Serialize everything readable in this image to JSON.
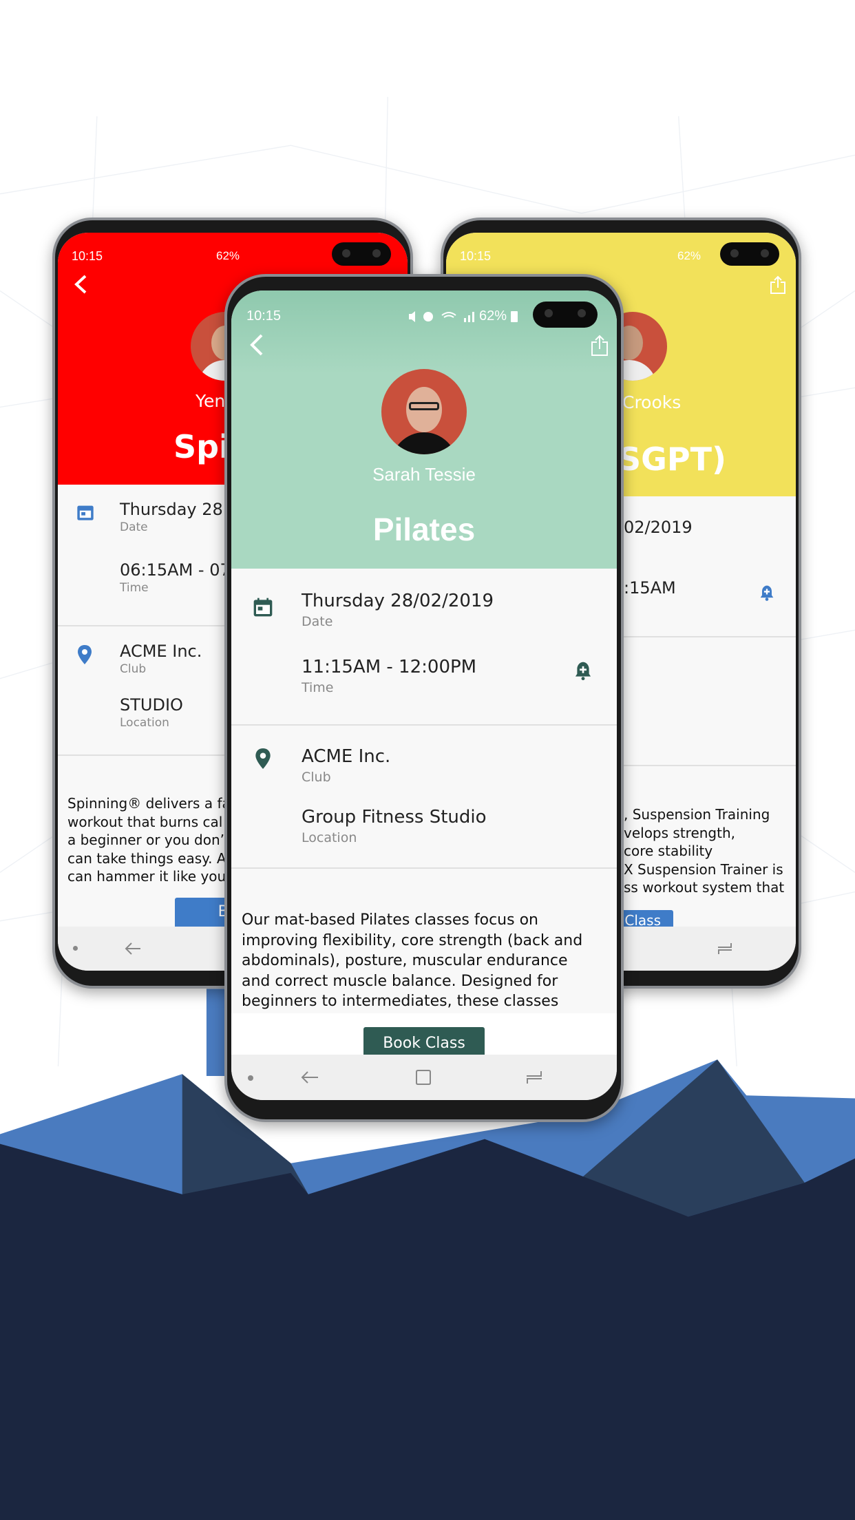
{
  "colors": {
    "red": "#ff0000",
    "yellow": "#f2e15a",
    "green": "#a9d8c1",
    "dark_green": "#2f5b53",
    "blue": "#3f7cc8",
    "navy": "#1b2640",
    "slate": "#2a3f5c",
    "sky": "#4a7bbf"
  },
  "status_bar": {
    "time": "10:15",
    "battery": "62%"
  },
  "left_phone": {
    "trainer": "Yen",
    "title": "Spin",
    "date": "Thursday  28",
    "date_label": "Date",
    "time": "06:15AM - 07",
    "time_label": "Time",
    "club": "ACME Inc.",
    "club_label": "Club",
    "location": "STUDIO",
    "location_label": "Location",
    "description": [
      "Spinning® delivers a fa",
      "workout that burns cal",
      "a beginner or you don’",
      "can take things easy. A",
      "can hammer it like you"
    ],
    "book_label": "Book"
  },
  "right_phone": {
    "trainer": "Crooks",
    "title": "SGPT)",
    "date": "02/2019",
    "time": ":15AM",
    "description": [
      ", Suspension Training",
      "velops strength,",
      "core stability",
      "X Suspension Trainer is",
      "ss workout system that"
    ],
    "book_label": "Class"
  },
  "center_phone": {
    "trainer": "Sarah Tessie",
    "title": "Pilates",
    "date": "Thursday  28/02/2019",
    "date_label": "Date",
    "time": "11:15AM - 12:00PM",
    "time_label": "Time",
    "club": "ACME Inc.",
    "club_label": "Club",
    "location": "Group Fitness Studio",
    "location_label": "Location",
    "description": [
      "Our mat-based Pilates classes focus on",
      "improving flexibility, core strength (back and",
      "abdominals), posture, muscular endurance",
      "and correct muscle balance. Designed for",
      "beginners to intermediates, these classes"
    ],
    "book_label": "Book Class"
  },
  "icons": [
    "back-arrow-icon",
    "share-icon",
    "calendar-icon",
    "bell-plus-icon",
    "location-pin-icon",
    "nav-back-icon",
    "nav-home-icon",
    "nav-recents-icon"
  ]
}
